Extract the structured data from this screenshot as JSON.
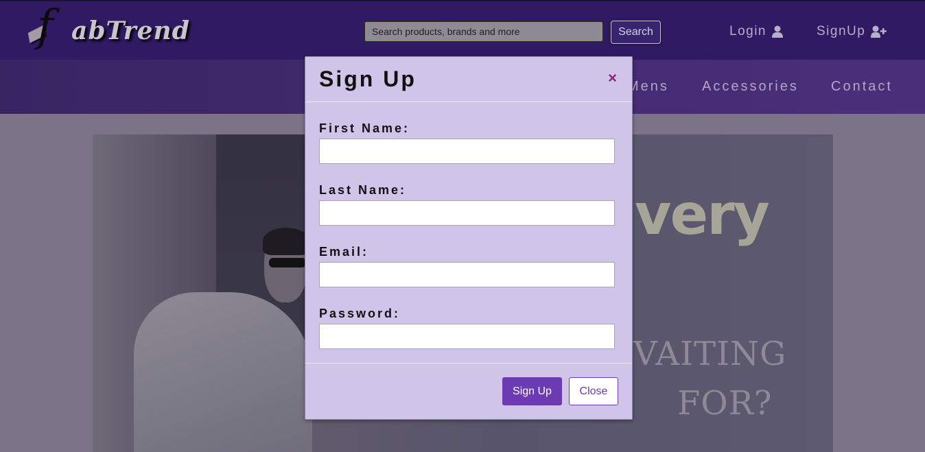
{
  "header": {
    "logo_text": "abTrend",
    "logo_letter": "f",
    "search": {
      "placeholder": "Search products, brands and more",
      "button_label": "Search"
    },
    "login_label": "Login",
    "signup_label": "SignUp"
  },
  "nav": {
    "items": [
      {
        "label": "Mens"
      },
      {
        "label": "Accessories"
      },
      {
        "label": "Contact"
      }
    ]
  },
  "hero": {
    "headline_fragment": "very",
    "line_1": "VAITING",
    "line_2": "FOR?"
  },
  "modal": {
    "title": "Sign Up",
    "close_symbol": "×",
    "fields": [
      {
        "label": "First Name:",
        "value": ""
      },
      {
        "label": "Last Name:",
        "value": ""
      },
      {
        "label": "Email:",
        "value": ""
      },
      {
        "label": "Password:",
        "value": ""
      }
    ],
    "submit_label": "Sign Up",
    "close_label": "Close"
  },
  "colors": {
    "header_bg": "#2f1a63",
    "modal_bg": "#d0c5e8",
    "accent": "#6c3bb3",
    "close_x": "#8a1f86"
  }
}
